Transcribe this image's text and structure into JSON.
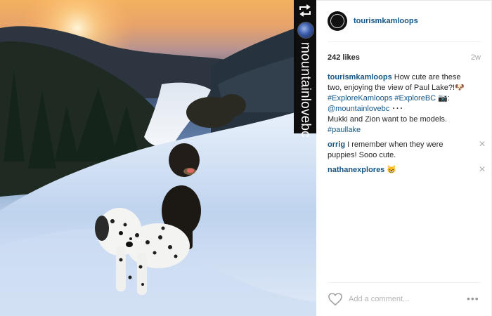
{
  "post": {
    "photo_alt": "",
    "repost": {
      "icon": "repost-icon",
      "username": "mountainlovebc"
    },
    "account": {
      "avatar_icon": "tourism-kamloops-logo",
      "username": "tourismkamloops"
    },
    "likes": "242 likes",
    "time_ago": "2w",
    "caption": {
      "user": "tourismkamloops",
      "line1": " How cute are these two, enjoying the view of Paul Lake?!🐶",
      "tag_explore_kamloops": "#ExploreKamloops",
      "tag_explore_bc": "#ExploreBC",
      "camera_emoji": "📷:",
      "mention": "@mountainlovebc",
      "dots": " ･･･",
      "line_models": "Mukki and Zion want to be models.",
      "tag_paul_lake": "#paullake"
    },
    "comments": [
      {
        "user": "orrig",
        "text": " I remember when they were puppies! Sooo cute."
      },
      {
        "user": "nathanexplores",
        "text": " 😸"
      }
    ],
    "add_comment_placeholder": "Add a comment...",
    "more_label": "•••",
    "close_glyph": "✕",
    "colors": {
      "username_blue": "#125688",
      "text": "#262626",
      "muted": "#a5a7aa"
    }
  }
}
